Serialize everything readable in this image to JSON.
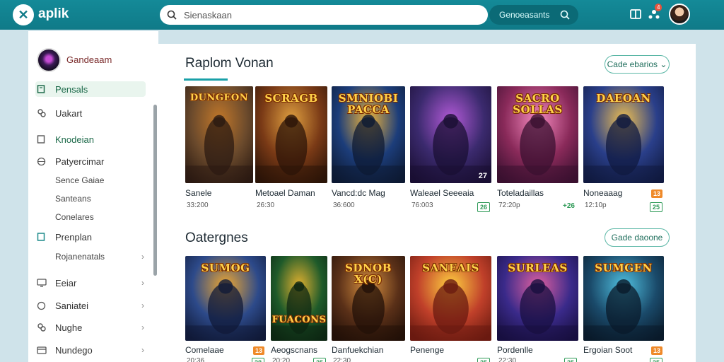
{
  "app": {
    "brand": "aplik",
    "logo_glyph": "✕"
  },
  "search": {
    "placeholder": "Sienaskaan",
    "button_label": "Genoeasants"
  },
  "header": {
    "notification_count": "4"
  },
  "sidebar": {
    "profile_name": "Gandeaam",
    "items": [
      {
        "label": "Pensals",
        "icon": "tablet-icon",
        "active": true
      },
      {
        "label": "Uakart",
        "icon": "link-icon"
      },
      {
        "label": "Knodeian",
        "icon": "tablet-icon"
      },
      {
        "label": "Patyercimar",
        "icon": "globe-icon"
      },
      {
        "label": "Sence Gaiae",
        "sub": true
      },
      {
        "label": "Santeans",
        "sub": true
      },
      {
        "label": "Conelares",
        "sub": true
      },
      {
        "label": "Prenplan",
        "icon": "tablet-icon"
      },
      {
        "label": "Rojanenatals",
        "sub": true,
        "chevron": "›"
      },
      {
        "label": "Eeiar",
        "icon": "monitor-icon",
        "chevron": "›"
      },
      {
        "label": "Saniatei",
        "icon": "globe-icon",
        "chevron": "›"
      },
      {
        "label": "Nughe",
        "icon": "link-icon",
        "chevron": "›"
      },
      {
        "label": "Nundego",
        "icon": "card-icon",
        "chevron": "›"
      }
    ]
  },
  "sections": [
    {
      "title": "Raplom Vonan",
      "button_label": "Cade ebarios ⌄",
      "cards": [
        {
          "title": "Sanele",
          "meta": "33:200",
          "thumb_text": "DUNGEON",
          "badge": ""
        },
        {
          "title": "Metoael Daman",
          "meta": "26:30",
          "thumb_text": "SCRAGB",
          "badge": ""
        },
        {
          "title": "Vancd:dc Mag",
          "meta": "36:600",
          "thumb_text": "SMNIOBI PACCA",
          "badge": ""
        },
        {
          "title": "Waleael Seeeaia",
          "meta": "76:003",
          "thumb_text": "",
          "corner": "27",
          "badge": "26"
        },
        {
          "title": "Toteladaillas",
          "meta": "72:20p",
          "thumb_text": "SACRO SOLLAS",
          "badge": "+26"
        },
        {
          "title": "Noneaaag",
          "meta": "12:10p",
          "thumb_text": "DAEOAN",
          "badge": "13",
          "badge2": "25"
        }
      ]
    },
    {
      "title": "Oatergnes",
      "button_label": "Gade daoone",
      "cards": [
        {
          "title": "Comelaae",
          "meta": "20:36",
          "thumb_text": "SUMOG",
          "badge": "13",
          "badge2": "28"
        },
        {
          "title": "Aeogscnans",
          "meta": "20:20",
          "thumb_text": "FUACONS",
          "badge": "25"
        },
        {
          "title": "Danfuekchian",
          "meta": "22:30",
          "thumb_text": "SDNOB X(C)",
          "badge": ""
        },
        {
          "title": "Penenge",
          "meta": "",
          "thumb_text": "SANEAIS",
          "badge": "25"
        },
        {
          "title": "Pordenlle",
          "meta": "22:30",
          "thumb_text": "SURLEAS",
          "badge": "25"
        },
        {
          "title": "Ergoian Soot",
          "meta": "",
          "thumb_text": "SUMGEN",
          "badge": "13",
          "badge2": "25"
        }
      ]
    }
  ],
  "colors": {
    "topbar": "#148a98",
    "accent": "#19a0a8",
    "badge_orange": "#ef8a2a",
    "badge_green": "#2e9a57"
  }
}
